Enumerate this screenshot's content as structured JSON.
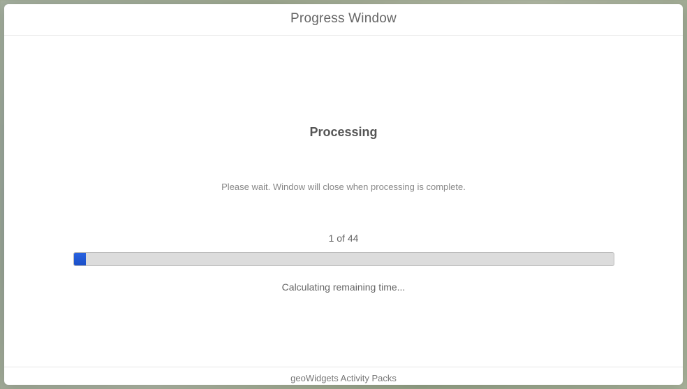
{
  "window": {
    "title": "Progress Window"
  },
  "body": {
    "heading": "Processing",
    "wait_message": "Please wait. Window will close when processing is complete.",
    "progress_count": "1 of 44",
    "progress_percent": 2.27,
    "progress_fill_width": "2.27%",
    "time_remaining": "Calculating remaining time..."
  },
  "footer": {
    "text": "geoWidgets Activity Packs"
  }
}
